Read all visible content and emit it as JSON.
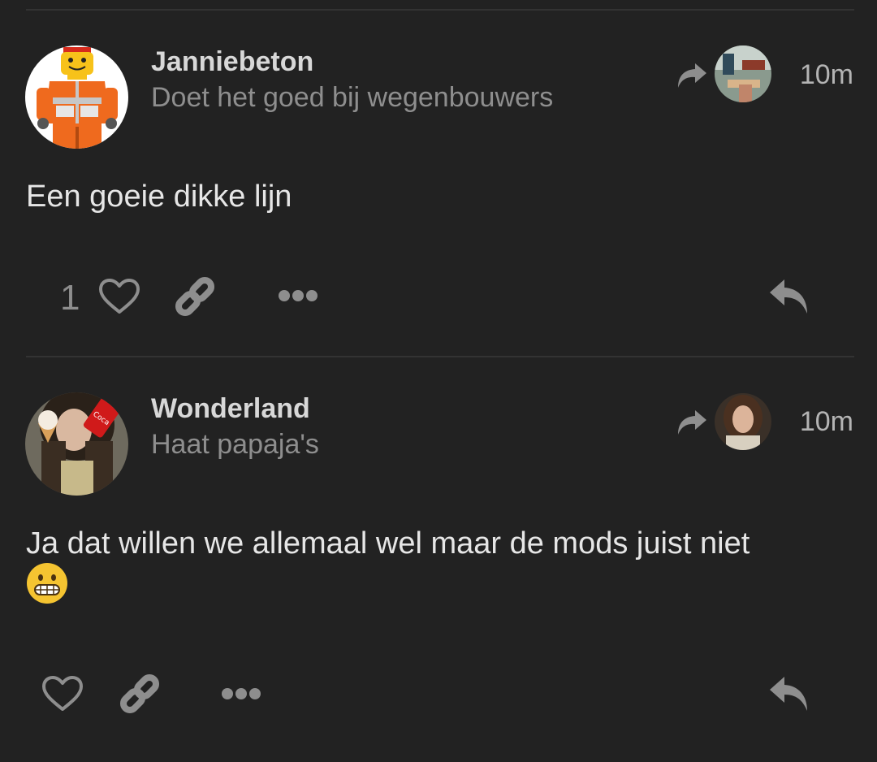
{
  "posts": [
    {
      "username": "Janniebeton",
      "tagline": "Doet het goed bij wegenbouwers",
      "time": "10m",
      "body": "Een goeie dikke lijn",
      "like_count": "1"
    },
    {
      "username": "Wonderland",
      "tagline": "Haat papaja's",
      "time": "10m",
      "body": "Ja dat willen we allemaal wel maar de mods juist niet",
      "emoji": "grimacing-face"
    }
  ],
  "colors": {
    "background": "#222222",
    "divider": "#333333",
    "username": "#d8d8d8",
    "tagline": "#8e8e8e",
    "icon": "#8e8e8e"
  }
}
